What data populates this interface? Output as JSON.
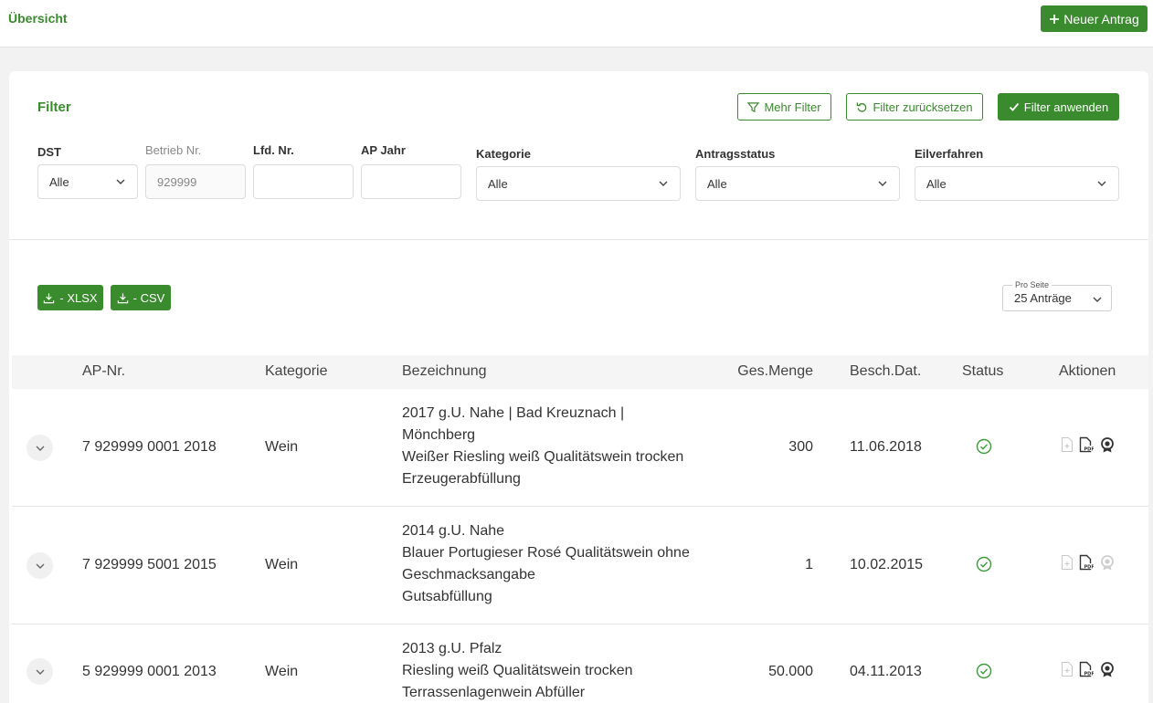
{
  "header": {
    "breadcrumb": "Übersicht",
    "new_button": "Neuer Antrag"
  },
  "filter": {
    "title": "Filter",
    "more_filters": "Mehr Filter",
    "reset": "Filter zurücksetzen",
    "apply": "Filter anwenden",
    "dst": {
      "label": "DST",
      "value": "Alle"
    },
    "betrieb": {
      "label": "Betrieb Nr.",
      "value": "929999"
    },
    "lfd": {
      "label": "Lfd. Nr.",
      "value": ""
    },
    "apjahr": {
      "label": "AP Jahr",
      "value": ""
    },
    "kategorie": {
      "label": "Kategorie",
      "value": "Alle"
    },
    "antragsstatus": {
      "label": "Antragsstatus",
      "value": "Alle"
    },
    "eilverfahren": {
      "label": "Eilverfahren",
      "value": "Alle"
    }
  },
  "export": {
    "xlsx": "- XLSX",
    "csv": "- CSV"
  },
  "pagination": {
    "label": "Pro Seite",
    "value": "25 Anträge"
  },
  "table": {
    "columns": {
      "apnr": "AP-Nr.",
      "kategorie": "Kategorie",
      "bezeichnung": "Bezeichnung",
      "menge": "Ges.Menge",
      "datum": "Besch.Dat.",
      "status": "Status",
      "aktionen": "Aktionen"
    },
    "rows": [
      {
        "apnr": "7 929999 0001 2018",
        "kategorie": "Wein",
        "lines": [
          "2017 g.U. Nahe | Bad Kreuznach |",
          "Mönchberg",
          "Weißer Riesling weiß Qualitätswein trocken",
          "Erzeugerabfüllung"
        ],
        "menge": "300",
        "datum": "11.06.2018",
        "status": "approved"
      },
      {
        "apnr": "7 929999 5001 2015",
        "kategorie": "Wein",
        "lines": [
          "2014 g.U. Nahe",
          "Blauer Portugieser Rosé Qualitätswein ohne",
          "Geschmacksangabe",
          "Gutsabfüllung"
        ],
        "menge": "1",
        "datum": "10.02.2015",
        "status": "approved"
      },
      {
        "apnr": "5 929999 0001 2013",
        "kategorie": "Wein",
        "lines": [
          "2013 g.U. Pfalz",
          "Riesling weiß Qualitätswein trocken",
          "Terrassenlagenwein Abfüller"
        ],
        "menge": "50.000",
        "datum": "04.11.2013",
        "status": "approved"
      }
    ]
  },
  "colors": {
    "accent": "#3a8a2e",
    "status_ok": "#3a9a3a"
  }
}
